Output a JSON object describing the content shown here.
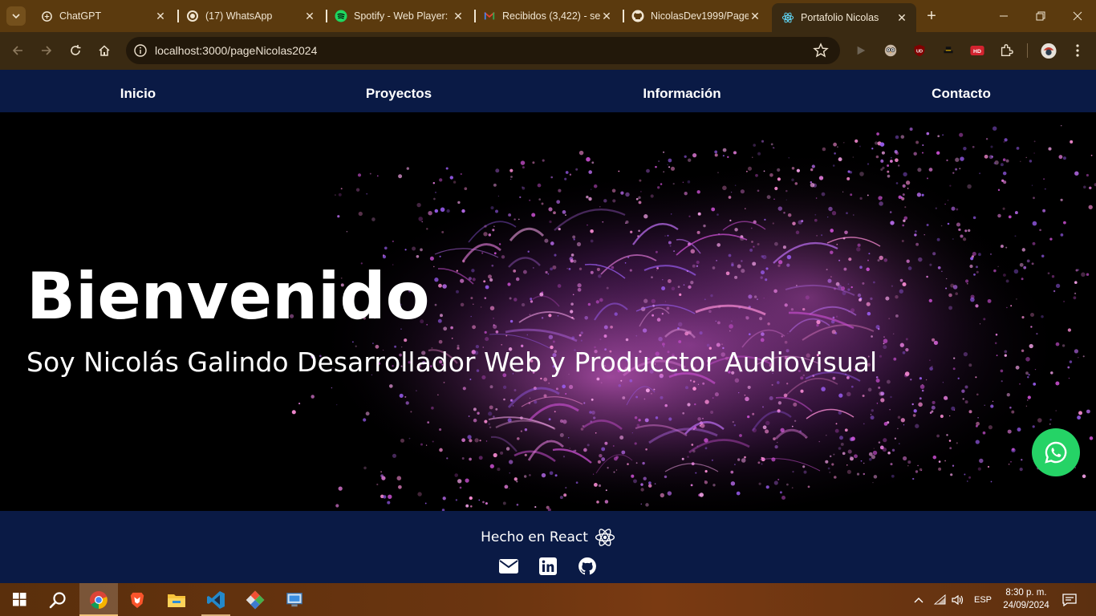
{
  "browser": {
    "tabs": [
      {
        "title": "ChatGPT",
        "icon": "chatgpt-icon"
      },
      {
        "title": "(17) WhatsApp",
        "icon": "whatsapp-icon"
      },
      {
        "title": "Spotify - Web Player:",
        "icon": "spotify-icon"
      },
      {
        "title": "Recibidos (3,422) - se",
        "icon": "gmail-icon"
      },
      {
        "title": "NicolasDev1999/Page",
        "icon": "github-icon"
      },
      {
        "title": "Portafolio Nicolas",
        "icon": "react-icon",
        "active": true
      }
    ],
    "url_host": "localhost",
    "url_path": ":3000/pageNicolas2024"
  },
  "site": {
    "nav": [
      "Inicio",
      "Proyectos",
      "Información",
      "Contacto"
    ],
    "hero": {
      "title": "Bienvenido",
      "subtitle": "Soy Nicolás Galindo Desarrollador Web y Producctor Audiovisual"
    },
    "footer": {
      "made_with": "Hecho en React",
      "icons": [
        "envelope-icon",
        "linkedin-icon",
        "github-icon"
      ]
    },
    "colors": {
      "nav_bg": "#0a1a45",
      "whatsapp_green": "#25d366",
      "particles": "#c04fd0"
    }
  },
  "taskbar": {
    "apps": [
      "start-icon",
      "search-icon",
      "chrome-icon",
      "brave-icon",
      "file-explorer-icon",
      "vscode-icon",
      "git-icon",
      "remote-desktop-icon"
    ],
    "language": "ESP",
    "time": "8:30 p. m.",
    "date": "24/09/2024"
  }
}
